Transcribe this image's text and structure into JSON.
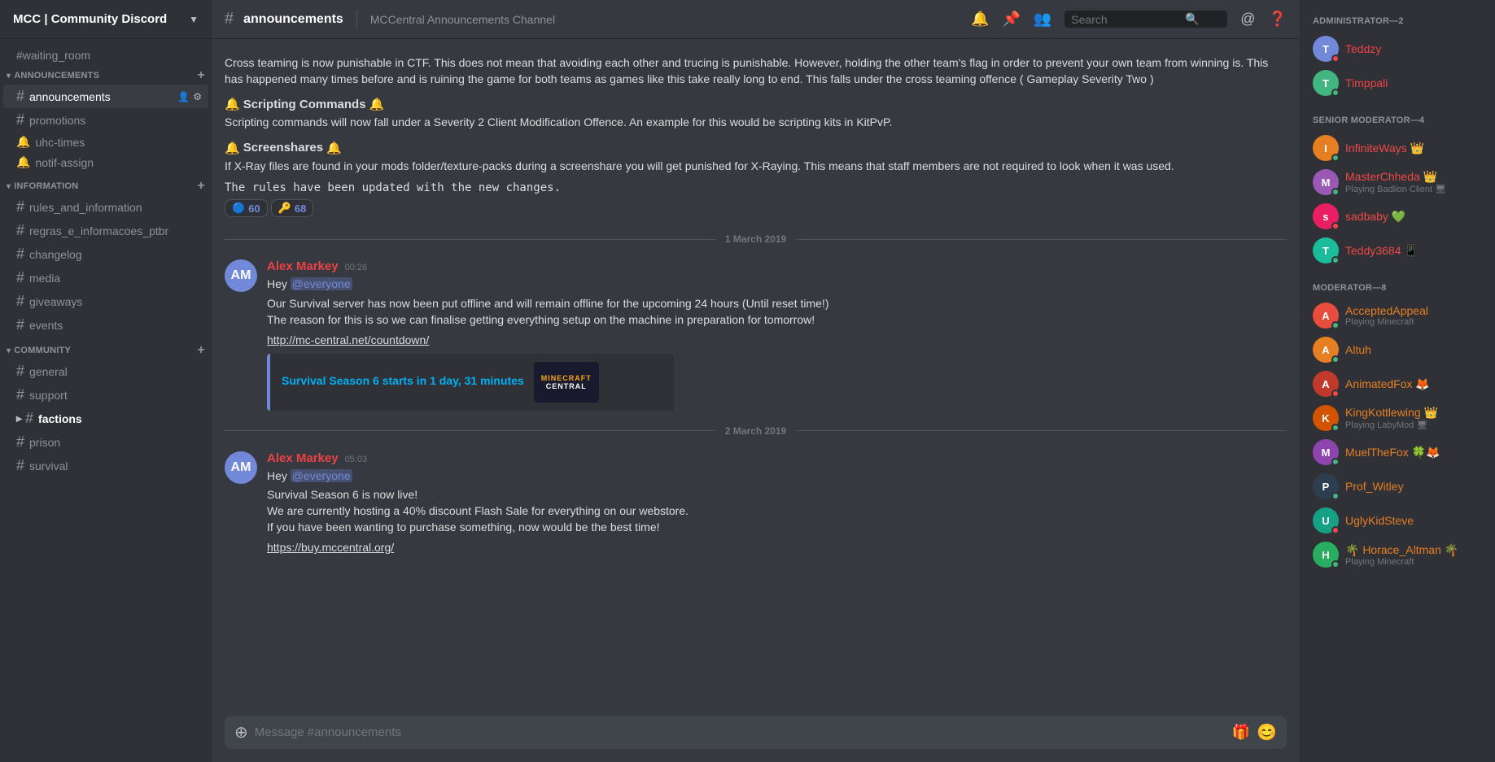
{
  "server": {
    "name": "MCC | Community Discord",
    "chevron": "▼"
  },
  "channels": {
    "standalone": [
      {
        "id": "waiting_room",
        "name": "waiting_room",
        "type": "hash"
      }
    ],
    "sections": [
      {
        "id": "announcements",
        "label": "ANNOUNCEMENTS",
        "channels": [
          {
            "id": "announcements",
            "name": "announcements",
            "active": true,
            "icons": [
              "person",
              "gear"
            ]
          },
          {
            "id": "promotions",
            "name": "promotions"
          },
          {
            "id": "uhc-times",
            "name": "uhc-times",
            "special": true
          },
          {
            "id": "notif-assign",
            "name": "notif-assign",
            "special": true
          }
        ]
      },
      {
        "id": "information",
        "label": "INFORMATION",
        "channels": [
          {
            "id": "rules_and_information",
            "name": "rules_and_information"
          },
          {
            "id": "regras_e_informacoes_ptbr",
            "name": "regras_e_informacoes_ptbr"
          },
          {
            "id": "changelog",
            "name": "changelog"
          },
          {
            "id": "media",
            "name": "media"
          },
          {
            "id": "giveaways",
            "name": "giveaways"
          },
          {
            "id": "events",
            "name": "events"
          }
        ]
      },
      {
        "id": "community",
        "label": "COMMUNITY",
        "channels": [
          {
            "id": "general",
            "name": "general"
          },
          {
            "id": "support",
            "name": "support"
          },
          {
            "id": "factions",
            "name": "factions",
            "highlighted": true
          },
          {
            "id": "prison",
            "name": "prison"
          },
          {
            "id": "survival",
            "name": "survival"
          }
        ]
      }
    ]
  },
  "channel_header": {
    "hash": "#",
    "name": "announcements",
    "desc": "MCCentral Announcements Channel",
    "icons": [
      "bell",
      "pin",
      "members",
      "search",
      "at",
      "help"
    ]
  },
  "search": {
    "placeholder": "Search"
  },
  "messages": [
    {
      "id": "msg1",
      "type": "continuation",
      "content": "Cross teaming is now punishable in CTF. This does not mean that avoiding each other and trucing is punishable. However, holding the other team's flag in order to prevent your own team from winning is. This has happened many times before and is ruining the game for both teams as games like this take really long to end.  This falls under the cross teaming offence ( Gameplay Severity Two )",
      "subsections": [
        {
          "icon": "🔔",
          "title": "Scripting Commands",
          "icon2": "🔔",
          "text": "Scripting commands will now fall under a Severity 2 Client Modification Offence. An example for this would be scripting kits in KitPvP."
        },
        {
          "icon": "🔔",
          "title": "Screenshares",
          "icon2": "🔔",
          "text": "If X-Ray files are found in your mods folder/texture-packs during a screenshare you will get punished for X-Raying. This means that staff members are not required to look when it was used."
        }
      ],
      "codeblock": "The rules have been updated with the new changes.",
      "reactions": [
        {
          "emoji": "🔵",
          "count": "60"
        },
        {
          "emoji": "🔑",
          "count": "68"
        }
      ]
    }
  ],
  "date_dividers": {
    "march1": "1 March 2019",
    "march2": "2 March 2019"
  },
  "msg_march1": {
    "time": "00:28",
    "author": "Alex Markey",
    "mention": "@everyone",
    "lines": [
      "Our Survival server has now been put offline and will remain offline for the upcoming 24 hours (Until reset time!)",
      "The reason for this is so we can finalise getting everything setup on the machine in preparation for tomorrow!"
    ],
    "link": "http://mc-central.net/countdown/",
    "embed": {
      "title": "Survival Season 6 starts in 1 day, 31 minutes",
      "image_text": "MINECRAFT\nCENTRAL"
    }
  },
  "msg_march2": {
    "time": "05:03",
    "author": "Alex Markey",
    "mention": "@everyone",
    "lines": [
      "Survival Season 6 is now live!",
      "We are currently hosting a 40% discount Flash Sale for everything on our webstore.",
      "If you have been wanting to purchase something, now would be the best time!"
    ],
    "link": "https://buy.mccentral.org/"
  },
  "members": {
    "administrator": {
      "label": "ADMINISTRATOR—2",
      "items": [
        {
          "id": "teddzy",
          "name": "Teddzy",
          "status": "dnd",
          "color": "#ed4245",
          "initials": "T",
          "bg": "#7289da"
        },
        {
          "id": "timppali",
          "name": "Timppali",
          "status": "online",
          "color": "#ed4245",
          "initials": "T",
          "bg": "#43b581"
        }
      ]
    },
    "senior_moderator": {
      "label": "SENIOR MODERATOR—4",
      "items": [
        {
          "id": "infiniteways",
          "name": "InfiniteWays",
          "badge": "👑",
          "status": "online",
          "color": "#f04747",
          "initials": "I",
          "bg": "#e67e22"
        },
        {
          "id": "masterchheda",
          "name": "MasterChheda",
          "badge": "👑",
          "status": "online",
          "color": "#f04747",
          "initials": "M",
          "bg": "#9b59b6",
          "game": "Playing Badlion Client 🖥"
        },
        {
          "id": "sadbaby",
          "name": "sadbaby",
          "badge": "💚",
          "status": "dnd",
          "color": "#f04747",
          "initials": "s",
          "bg": "#e91e63"
        },
        {
          "id": "teddy3684",
          "name": "Teddy3684",
          "badge": "📱",
          "status": "online",
          "color": "#f04747",
          "initials": "T",
          "bg": "#1abc9c"
        }
      ]
    },
    "moderator": {
      "label": "MODERATOR—8",
      "items": [
        {
          "id": "acceptedappeal",
          "name": "AcceptedAppeal",
          "status": "online",
          "color": "#e67e22",
          "initials": "A",
          "bg": "#e74c3c",
          "game": "Playing Minecraft"
        },
        {
          "id": "altuh",
          "name": "Altuh",
          "status": "online",
          "color": "#e67e22",
          "initials": "A",
          "bg": "#e67e22"
        },
        {
          "id": "animatedfox",
          "name": "AnimatedFox",
          "badge": "🦊",
          "status": "dnd",
          "color": "#e67e22",
          "initials": "A",
          "bg": "#c0392b"
        },
        {
          "id": "kingkottlewing",
          "name": "KingKottlewing",
          "badge": "👑",
          "status": "online",
          "color": "#e67e22",
          "initials": "K",
          "bg": "#d35400",
          "game": "Playing LabyMod 🖥"
        },
        {
          "id": "muelthefox",
          "name": "MuelTheFox",
          "badge": "🍀🦊",
          "status": "online",
          "color": "#e67e22",
          "initials": "M",
          "bg": "#8e44ad"
        },
        {
          "id": "prof_witley",
          "name": "Prof_Witley",
          "status": "online",
          "color": "#e67e22",
          "initials": "P",
          "bg": "#2c3e50"
        },
        {
          "id": "uglykidsteve",
          "name": "UglyKidSteve",
          "status": "dnd",
          "color": "#e67e22",
          "initials": "U",
          "bg": "#16a085"
        },
        {
          "id": "horace_altman",
          "name": "🌴 Horace_Altman 🌴",
          "status": "online",
          "color": "#e67e22",
          "initials": "H",
          "bg": "#27ae60",
          "game": "Playing Minecraft"
        }
      ]
    }
  },
  "message_input": {
    "placeholder": "Message #announcements"
  },
  "reactions_row1": {
    "emoji": "🔵",
    "count": "60"
  },
  "reactions_row2": {
    "emoji": "🔑",
    "count": "68"
  }
}
